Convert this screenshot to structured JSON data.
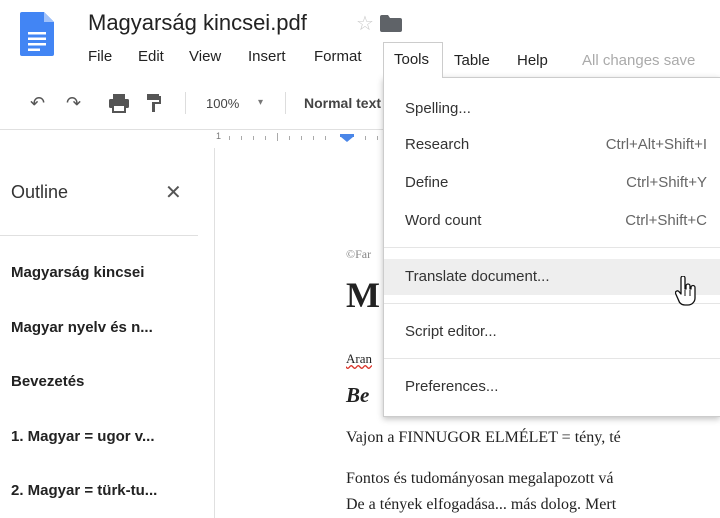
{
  "header": {
    "title": "Magyarság kincsei.pdf",
    "star_glyph": "☆"
  },
  "menubar": {
    "items": [
      "File",
      "Edit",
      "View",
      "Insert",
      "Format",
      "Tools",
      "Table",
      "Help"
    ],
    "status": "All changes save"
  },
  "toolbar": {
    "zoom": "100%",
    "zoom_caret": "▾",
    "style": "Normal text",
    "undo_icon": "↶",
    "redo_icon": "↷"
  },
  "ruler": {
    "digit": "1"
  },
  "outline": {
    "title": "Outline",
    "close_glyph": "✕",
    "items": [
      "Magyarság kincsei",
      "Magyar nyelv és n...",
      "Bevezetés",
      "1. Magyar = ugor v...",
      "2. Magyar = türk-tu..."
    ]
  },
  "document": {
    "copyright": "©Far",
    "big_heading": "M",
    "author": "Aran",
    "section": "Be",
    "line1": "Vajon a FINNUGOR ELMÉLET = tény, té",
    "line2": "Fontos és tudományosan megalapozott vá",
    "line3": "De a tények elfogadása... más dolog. Mert"
  },
  "tools_menu": {
    "items": [
      {
        "label": "Spelling...",
        "shortcut": ""
      },
      {
        "label": "Research",
        "shortcut": "Ctrl+Alt+Shift+I"
      },
      {
        "label": "Define",
        "shortcut": "Ctrl+Shift+Y"
      },
      {
        "label": "Word count",
        "shortcut": "Ctrl+Shift+C"
      },
      {
        "label": "Translate document...",
        "shortcut": ""
      },
      {
        "label": "Script editor...",
        "shortcut": ""
      },
      {
        "label": "Preferences...",
        "shortcut": ""
      }
    ]
  },
  "colors": {
    "doc_icon": "#4285f4",
    "folder": "#5f6368",
    "hover": "#eeeeee"
  }
}
